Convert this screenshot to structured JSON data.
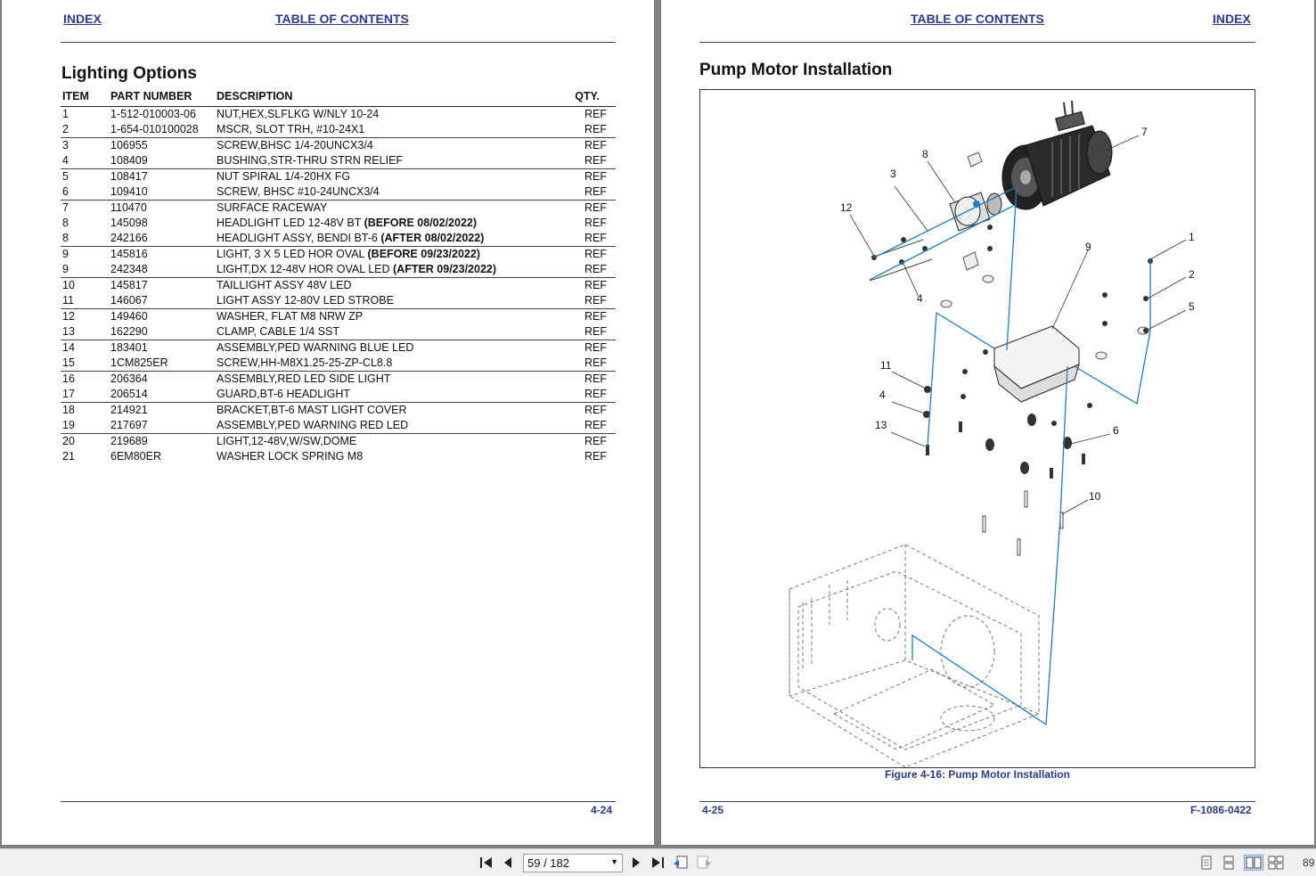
{
  "left_page": {
    "nav_index": "INDEX",
    "nav_toc": "TABLE OF CONTENTS",
    "title": "Lighting Options",
    "columns": {
      "item": "ITEM",
      "part": "PART NUMBER",
      "desc": "DESCRIPTION",
      "qty": "QTY."
    },
    "rows": [
      {
        "item": "1",
        "part": "1-512-010003-06",
        "desc": "NUT,HEX,SLFLKG W/NLY 10-24",
        "desc_bold": "",
        "qty": "REF",
        "group_start": true
      },
      {
        "item": "2",
        "part": "1-654-010100028",
        "desc": "MSCR, SLOT TRH, #10-24X1",
        "desc_bold": "",
        "qty": "REF",
        "group_start": false
      },
      {
        "item": "3",
        "part": "106955",
        "desc": "SCREW,BHSC 1/4-20UNCX3/4",
        "desc_bold": "",
        "qty": "REF",
        "group_start": true
      },
      {
        "item": "4",
        "part": "108409",
        "desc": "BUSHING,STR-THRU STRN RELIEF",
        "desc_bold": "",
        "qty": "REF",
        "group_start": false
      },
      {
        "item": "5",
        "part": "108417",
        "desc": "NUT SPIRAL 1/4-20HX FG",
        "desc_bold": "",
        "qty": "REF",
        "group_start": true
      },
      {
        "item": "6",
        "part": "109410",
        "desc": "SCREW, BHSC #10-24UNCX3/4",
        "desc_bold": "",
        "qty": "REF",
        "group_start": false
      },
      {
        "item": "7",
        "part": "110470",
        "desc": "SURFACE RACEWAY",
        "desc_bold": "",
        "qty": "REF",
        "group_start": true
      },
      {
        "item": "8",
        "part": "145098",
        "desc": "HEADLIGHT LED 12-48V BT ",
        "desc_bold": "(BEFORE 08/02/2022)",
        "qty": "REF",
        "group_start": false
      },
      {
        "item": "8",
        "part": "242166",
        "desc": "HEADLIGHT ASSY, BENDI BT-6 ",
        "desc_bold": "(AFTER 08/02/2022)",
        "qty": "REF",
        "group_start": false
      },
      {
        "item": "9",
        "part": "145816",
        "desc": "LIGHT, 3 X 5 LED HOR OVAL ",
        "desc_bold": "(BEFORE 09/23/2022)",
        "qty": "REF",
        "group_start": true
      },
      {
        "item": "9",
        "part": "242348",
        "desc": "LIGHT,DX 12-48V HOR OVAL LED ",
        "desc_bold": "(AFTER 09/23/2022)",
        "qty": "REF",
        "group_start": false
      },
      {
        "item": "10",
        "part": "145817",
        "desc": "TAILLIGHT ASSY 48V LED",
        "desc_bold": "",
        "qty": "REF",
        "group_start": true
      },
      {
        "item": "11",
        "part": "146067",
        "desc": "LIGHT ASSY 12-80V LED STROBE",
        "desc_bold": "",
        "qty": "REF",
        "group_start": false
      },
      {
        "item": "12",
        "part": "149460",
        "desc": "WASHER, FLAT M8 NRW ZP",
        "desc_bold": "",
        "qty": "REF",
        "group_start": true
      },
      {
        "item": "13",
        "part": "162290",
        "desc": "CLAMP, CABLE 1/4 SST",
        "desc_bold": "",
        "qty": "REF",
        "group_start": false
      },
      {
        "item": "14",
        "part": "183401",
        "desc": "ASSEMBLY,PED WARNING BLUE LED",
        "desc_bold": "",
        "qty": "REF",
        "group_start": true
      },
      {
        "item": "15",
        "part": "1CM825ER",
        "desc": "SCREW,HH-M8X1.25-25-ZP-CL8.8",
        "desc_bold": "",
        "qty": "REF",
        "group_start": false
      },
      {
        "item": "16",
        "part": "206364",
        "desc": "ASSEMBLY,RED LED SIDE LIGHT",
        "desc_bold": "",
        "qty": "REF",
        "group_start": true
      },
      {
        "item": "17",
        "part": "206514",
        "desc": "GUARD,BT-6 HEADLIGHT",
        "desc_bold": "",
        "qty": "REF",
        "group_start": false
      },
      {
        "item": "18",
        "part": "214921",
        "desc": "BRACKET,BT-6 MAST LIGHT COVER",
        "desc_bold": "",
        "qty": "REF",
        "group_start": true
      },
      {
        "item": "19",
        "part": "217697",
        "desc": "ASSEMBLY,PED WARNING RED LED",
        "desc_bold": "",
        "qty": "REF",
        "group_start": false
      },
      {
        "item": "20",
        "part": "219689",
        "desc": "LIGHT,12-48V,W/SW,DOME",
        "desc_bold": "",
        "qty": "REF",
        "group_start": true
      },
      {
        "item": "21",
        "part": "6EM80ER",
        "desc": "WASHER LOCK SPRING M8",
        "desc_bold": "",
        "qty": "REF",
        "group_start": false
      }
    ],
    "page_number": "4-24"
  },
  "right_page": {
    "nav_toc": "TABLE OF CONTENTS",
    "nav_index": "INDEX",
    "title": "Pump Motor Installation",
    "figure_caption": "Figure 4-16:  Pump Motor Installation",
    "callouts": [
      "1",
      "2",
      "3",
      "4",
      "4",
      "5",
      "6",
      "7",
      "8",
      "9",
      "10",
      "11",
      "12",
      "13"
    ],
    "page_number": "4-25",
    "doc_number": "F-1086-0422"
  },
  "toolbar": {
    "page_indicator": "59 / 182",
    "zoom": "89"
  },
  "colors": {
    "link": "#2b3a8f",
    "leader": "#1a7fc1"
  }
}
